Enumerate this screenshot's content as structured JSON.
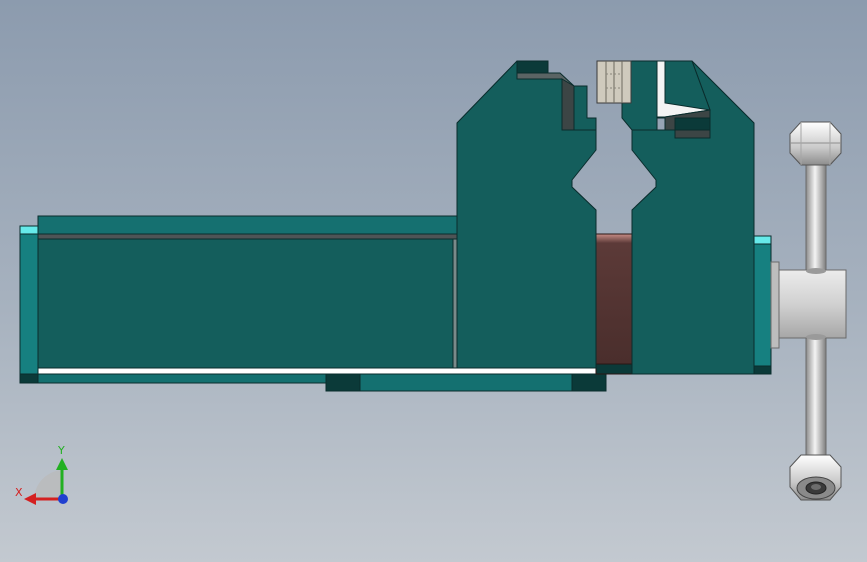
{
  "viewport": {
    "background_top": "#8c9bae",
    "background_bottom": "#c3c9d0"
  },
  "model": {
    "body_color": "#145e5c",
    "body_dark": "#0b3a39",
    "highlight_color": "#5fe8e8",
    "guide_color": "#5c3a38",
    "handle_color": "#d8d8d8",
    "jaw_insert_color": "#cfcabd"
  },
  "triad": {
    "x_label": "X",
    "y_label": "Y",
    "x_color": "#d42020",
    "y_color": "#22b022",
    "z_color": "#2040d0"
  }
}
